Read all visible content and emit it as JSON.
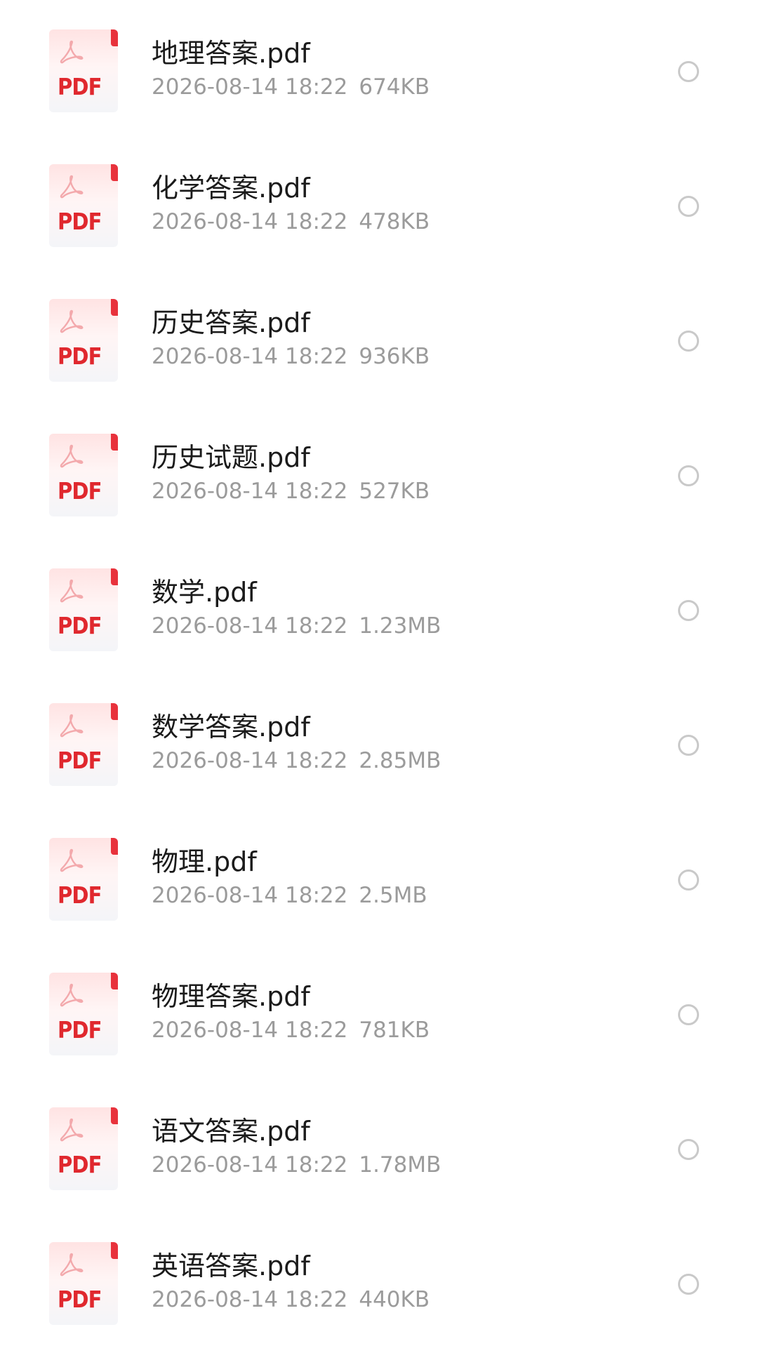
{
  "files": [
    {
      "name": "地理答案.pdf",
      "date": "2026-08-14 18:22",
      "size": "674KB",
      "icon": "pdf-file-icon",
      "icon_label": "PDF"
    },
    {
      "name": "化学答案.pdf",
      "date": "2026-08-14 18:22",
      "size": "478KB",
      "icon": "pdf-file-icon",
      "icon_label": "PDF"
    },
    {
      "name": "历史答案.pdf",
      "date": "2026-08-14 18:22",
      "size": "936KB",
      "icon": "pdf-file-icon",
      "icon_label": "PDF"
    },
    {
      "name": "历史试题.pdf",
      "date": "2026-08-14 18:22",
      "size": "527KB",
      "icon": "pdf-file-icon",
      "icon_label": "PDF"
    },
    {
      "name": "数学.pdf",
      "date": "2026-08-14 18:22",
      "size": "1.23MB",
      "icon": "pdf-file-icon",
      "icon_label": "PDF"
    },
    {
      "name": "数学答案.pdf",
      "date": "2026-08-14 18:22",
      "size": "2.85MB",
      "icon": "pdf-file-icon",
      "icon_label": "PDF"
    },
    {
      "name": "物理.pdf",
      "date": "2026-08-14 18:22",
      "size": "2.5MB",
      "icon": "pdf-file-icon",
      "icon_label": "PDF"
    },
    {
      "name": "物理答案.pdf",
      "date": "2026-08-14 18:22",
      "size": "781KB",
      "icon": "pdf-file-icon",
      "icon_label": "PDF"
    },
    {
      "name": "语文答案.pdf",
      "date": "2026-08-14 18:22",
      "size": "1.78MB",
      "icon": "pdf-file-icon",
      "icon_label": "PDF"
    },
    {
      "name": "英语答案.pdf",
      "date": "2026-08-14 18:22",
      "size": "440KB",
      "icon": "pdf-file-icon",
      "icon_label": "PDF"
    }
  ],
  "colors": {
    "background": "#ffffff",
    "pdf_red": "#e0282e",
    "name_text": "#1b1b1b",
    "meta_text": "#9b9b9b",
    "select_circle": "#c9c9c9"
  }
}
